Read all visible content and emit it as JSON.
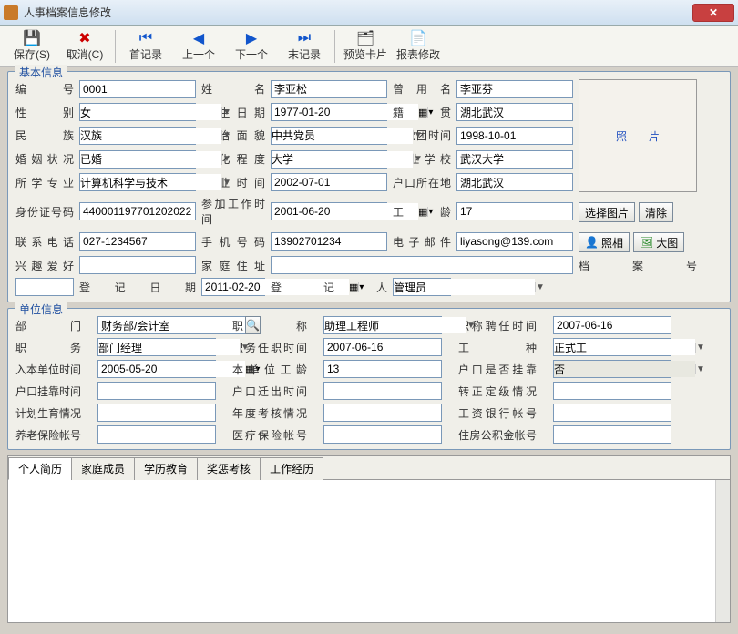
{
  "window": {
    "title": "人事档案信息修改"
  },
  "toolbar": {
    "save": "保存(S)",
    "cancel": "取消(C)",
    "first": "首记录",
    "prev": "上一个",
    "next": "下一个",
    "last": "末记录",
    "preview": "预览卡片",
    "report": "报表修改"
  },
  "groups": {
    "basic": "基本信息",
    "unit": "单位信息"
  },
  "labels": {
    "id": "编    号",
    "name": "姓    名",
    "former": "曾 用 名",
    "gender": "性    别",
    "birth": "出生日期",
    "native": "籍    贯",
    "ethnic": "民    族",
    "politic": "政治面貌",
    "party": "入党团时间",
    "marital": "婚姻状况",
    "edu": "文化程度",
    "gradschool": "毕业学校",
    "major": "所学专业",
    "gradtime": "毕业时间",
    "hukou": "户口所在地",
    "idno": "身份证号码",
    "worktime": "参加工作时间",
    "seniority": "工    龄",
    "phone": "联系电话",
    "mobile": "手机号码",
    "email": "电子邮件",
    "hobby": "兴趣爱好",
    "address": "家庭住址",
    "fileno": "档 案 号",
    "regdate": "登记日期",
    "regby": "登 记 人",
    "photo": "照片",
    "selimg": "选择图片",
    "clear": "清除",
    "takephoto": "照相",
    "bigimg": "大图",
    "dept": "部    门",
    "title": "职    称",
    "titledate": "职称聘任时间",
    "duty": "职    务",
    "dutydate": "职务任职时间",
    "worktype": "工    种",
    "joindate": "入本单位时间",
    "localsen": "本单位工龄",
    "attach": "户口是否挂靠",
    "attachdate": "户口挂靠时间",
    "movedate": "户口迁出时间",
    "grade": "转正定级情况",
    "birthplan": "计划生育情况",
    "yearcheck": "年度考核情况",
    "bank": "工资银行帐号",
    "pension": "养老保险帐号",
    "medical": "医疗保险帐号",
    "housing": "住房公积金帐号"
  },
  "values": {
    "id": "0001",
    "name": "李亚松",
    "former": "李亚芬",
    "gender": "女",
    "birth": "1977-01-20",
    "native": "湖北武汉",
    "ethnic": "汉族",
    "politic": "中共党员",
    "party": "1998-10-01",
    "marital": "已婚",
    "edu": "大学",
    "gradschool": "武汉大学",
    "major": "计算机科学与技术",
    "gradtime": "2002-07-01",
    "hukou": "湖北武汉",
    "idno": "440001197701202022",
    "worktime": "2001-06-20",
    "seniority": "17",
    "phone": "027-1234567",
    "mobile": "13902701234",
    "email": "liyasong@139.com",
    "hobby": "",
    "address": "",
    "fileno": "",
    "regdate": "2011-02-20",
    "regby": "管理员",
    "dept": "财务部/会计室",
    "title": "助理工程师",
    "titledate": "2007-06-16",
    "duty": "部门经理",
    "dutydate": "2007-06-16",
    "worktype": "正式工",
    "joindate": "2005-05-20",
    "localsen": "13",
    "attach": "否",
    "attachdate": "",
    "movedate": "",
    "grade": "",
    "birthplan": "",
    "yearcheck": "",
    "bank": "",
    "pension": "",
    "medical": "",
    "housing": ""
  },
  "tabs": [
    "个人简历",
    "家庭成员",
    "学历教育",
    "奖惩考核",
    "工作经历"
  ]
}
